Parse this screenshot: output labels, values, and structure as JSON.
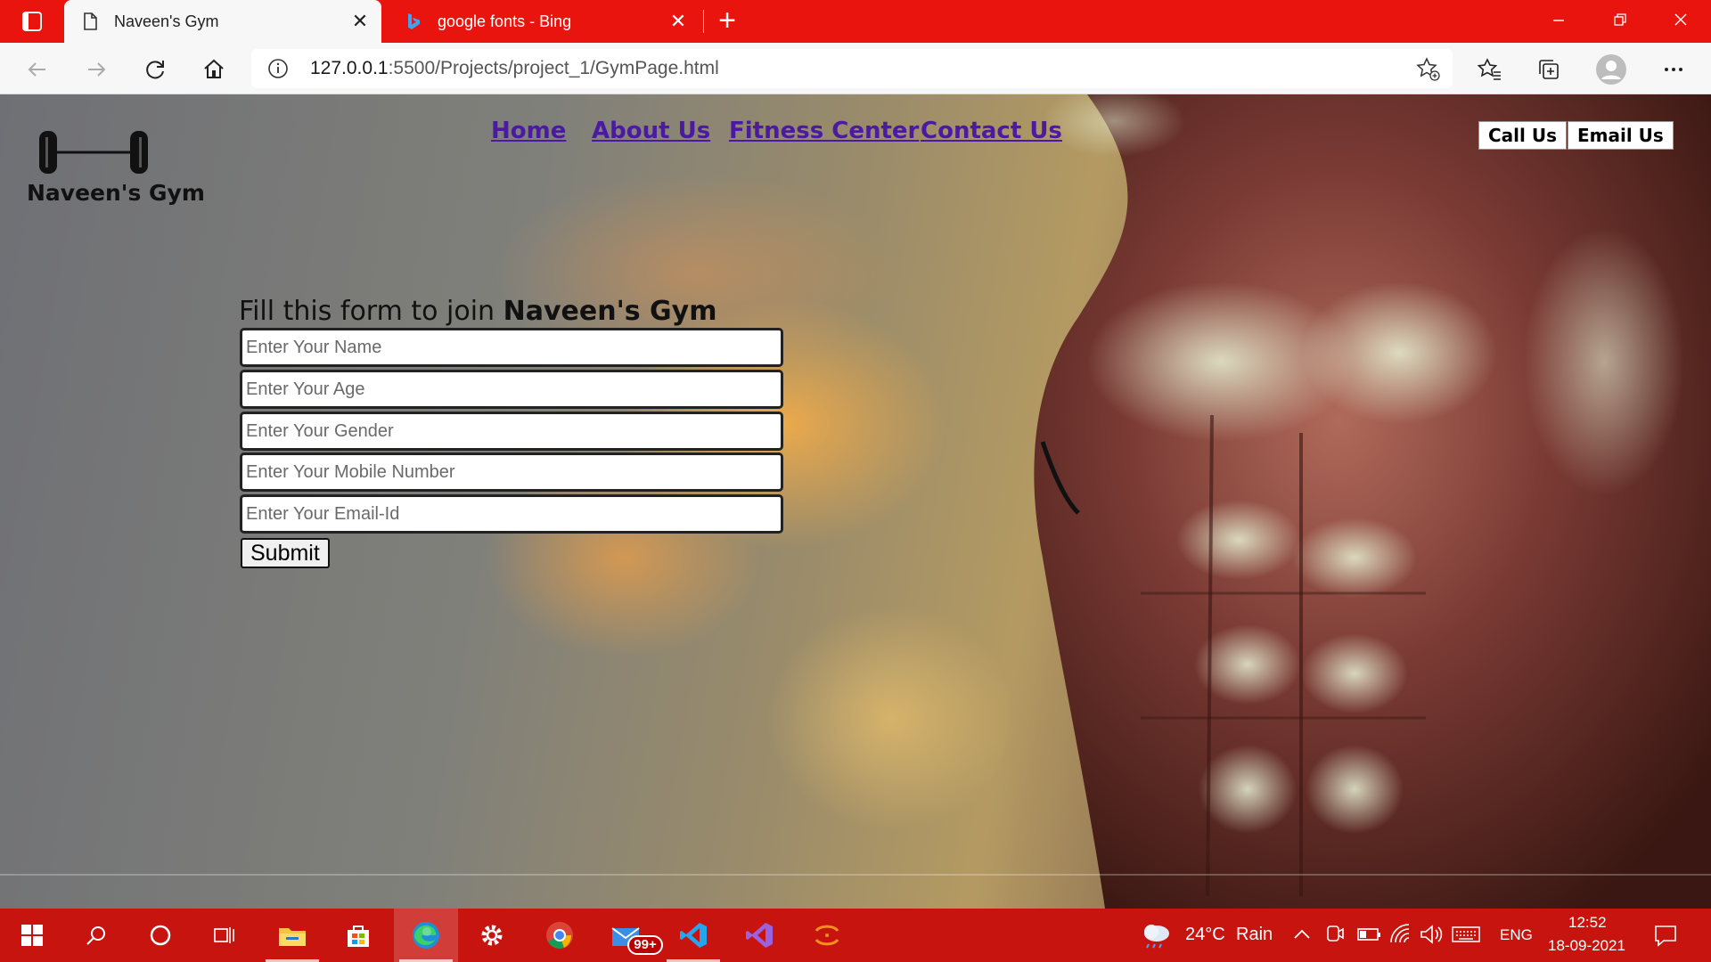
{
  "browser": {
    "tabs": [
      {
        "title": "Naveen's Gym",
        "active": true
      },
      {
        "title": "google fonts - Bing",
        "active": false
      }
    ],
    "url_host": "127.0.0.1",
    "url_path": ":5500/Projects/project_1/GymPage.html"
  },
  "page": {
    "brand": "Naveen's Gym",
    "nav": [
      "Home",
      "About Us",
      "Fitness Center",
      "Contact Us"
    ],
    "contact_buttons": [
      "Call Us",
      "Email Us"
    ],
    "form": {
      "heading_prefix": "Fill this form to join ",
      "heading_bold": "Naveen's Gym",
      "fields": [
        {
          "placeholder": "Enter Your Name"
        },
        {
          "placeholder": "Enter Your Age"
        },
        {
          "placeholder": "Enter Your Gender"
        },
        {
          "placeholder": "Enter Your Mobile Number"
        },
        {
          "placeholder": "Enter Your Email-Id"
        }
      ],
      "submit_label": "Submit"
    }
  },
  "taskbar": {
    "mail_badge": "99+",
    "weather": "24°C",
    "weather_desc": "Rain",
    "language": "ENG",
    "time": "12:52",
    "date": "18-09-2021"
  },
  "colors": {
    "chrome_red": "#e8140d",
    "taskbar_red": "#c7140f",
    "nav_link": "#4b1aa0"
  }
}
